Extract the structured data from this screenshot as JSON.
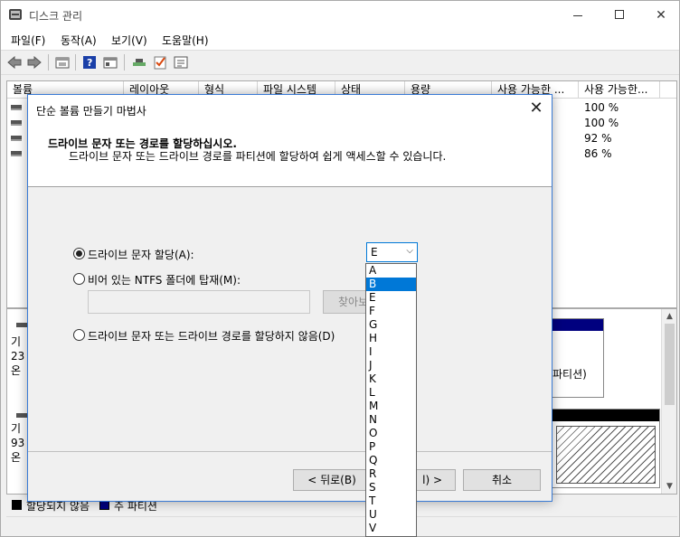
{
  "window": {
    "title": "디스크 관리"
  },
  "menu": [
    "파일(F)",
    "동작(A)",
    "보기(V)",
    "도움말(H)"
  ],
  "volume_list": {
    "columns": [
      "볼륨",
      "레이아웃",
      "형식",
      "파일 시스템",
      "상태",
      "용량",
      "사용 가능한 ...",
      "사용 가능한..."
    ],
    "rows": [
      {
        "free_pct": "100 %"
      },
      {
        "free_pct": "100 %"
      },
      {
        "free_pct": "92 %"
      },
      {
        "free_pct": "86 %"
      }
    ]
  },
  "disk_map": {
    "disk1_lines": [
      "기",
      "23",
      "온"
    ],
    "disk2_lines": [
      "기",
      "93",
      "온"
    ],
    "partition_label": "파티션)"
  },
  "legend": {
    "unallocated": "할당되지 않음",
    "primary": "주 파티션"
  },
  "colors": {
    "unallocated": "#000000",
    "primary": "#00007f",
    "accent": "#0078d7"
  },
  "dialog": {
    "title": "단순 볼륨 만들기 마법사",
    "heading": "드라이브 문자 또는 경로를 할당하십시오.",
    "subheading": "드라이브 문자 또는 드라이브 경로를 파티션에 할당하여 쉽게 액세스할 수 있습니다.",
    "option_assign": "드라이브 문자 할당(A):",
    "option_mount": "비어 있는 NTFS 폴더에 탑재(M):",
    "option_none": "드라이브 문자 또는 드라이브 경로를 할당하지 않음(D)",
    "browse": "찾아보",
    "selected_letter": "E",
    "back": "< 뒤로(B)",
    "next": "l) >",
    "cancel": "취소"
  },
  "dropdown": {
    "items": [
      "A",
      "B",
      "E",
      "F",
      "G",
      "H",
      "I",
      "J",
      "K",
      "L",
      "M",
      "N",
      "O",
      "P",
      "Q",
      "R",
      "S",
      "T",
      "U",
      "V"
    ],
    "highlighted": "B"
  }
}
